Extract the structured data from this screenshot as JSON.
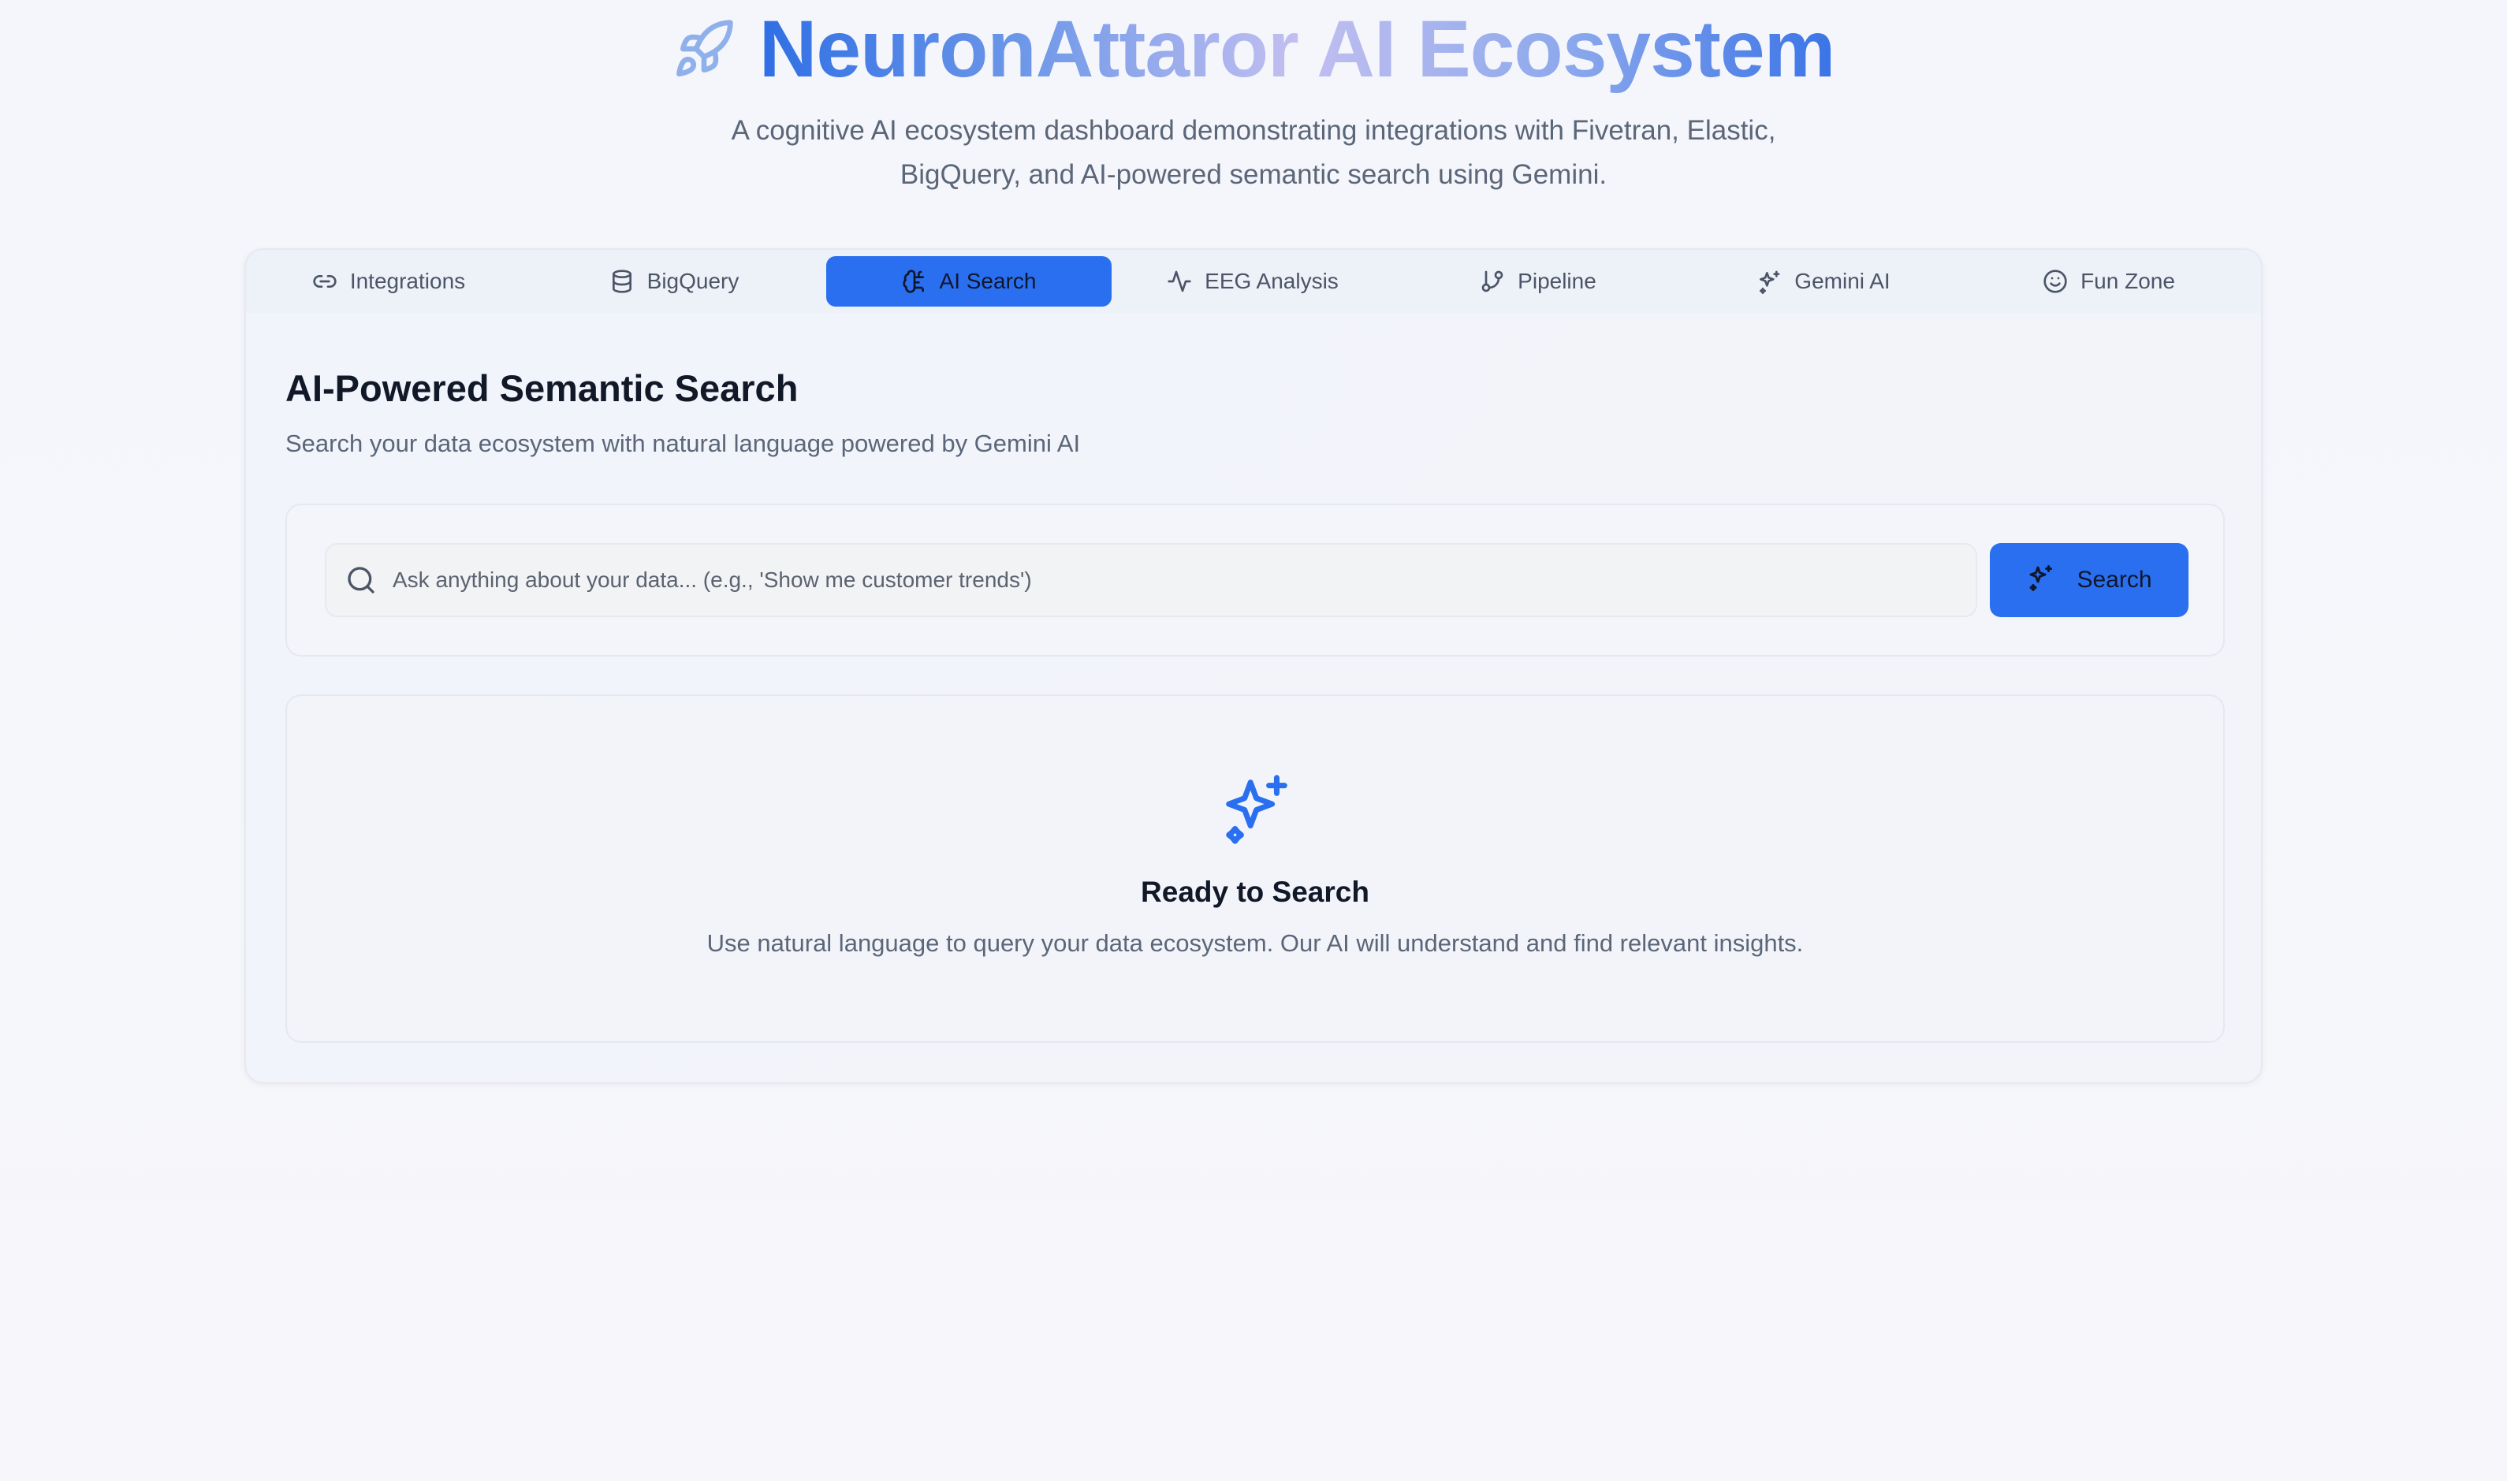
{
  "header": {
    "title": "NeuronAttaror AI Ecosystem",
    "subtitle": "A cognitive AI ecosystem dashboard demonstrating integrations with Fivetran, Elastic, BigQuery, and AI-powered semantic search using Gemini.",
    "icon": "rocket-icon"
  },
  "tabs": [
    {
      "label": "Integrations",
      "icon": "link-icon",
      "active": false
    },
    {
      "label": "BigQuery",
      "icon": "database-icon",
      "active": false
    },
    {
      "label": "AI Search",
      "icon": "brain-icon",
      "active": true
    },
    {
      "label": "EEG Analysis",
      "icon": "activity-icon",
      "active": false
    },
    {
      "label": "Pipeline",
      "icon": "git-branch-icon",
      "active": false
    },
    {
      "label": "Gemini AI",
      "icon": "sparkles-icon",
      "active": false
    },
    {
      "label": "Fun Zone",
      "icon": "smile-icon",
      "active": false
    }
  ],
  "main": {
    "title": "AI-Powered Semantic Search",
    "description": "Search your data ecosystem with natural language powered by Gemini AI",
    "search": {
      "placeholder": "Ask anything about your data... (e.g., 'Show me customer trends')",
      "value": "",
      "button_label": "Search"
    },
    "empty_state": {
      "title": "Ready to Search",
      "description": "Use natural language to query your data ecosystem. Our AI will understand and find relevant insights.",
      "icon": "sparkles-icon"
    }
  },
  "colors": {
    "accent": "#2a6ff0",
    "title_gradient_start": "#2f6fe4",
    "title_gradient_mid": "#c2bff0",
    "text_muted": "#5b6678"
  }
}
